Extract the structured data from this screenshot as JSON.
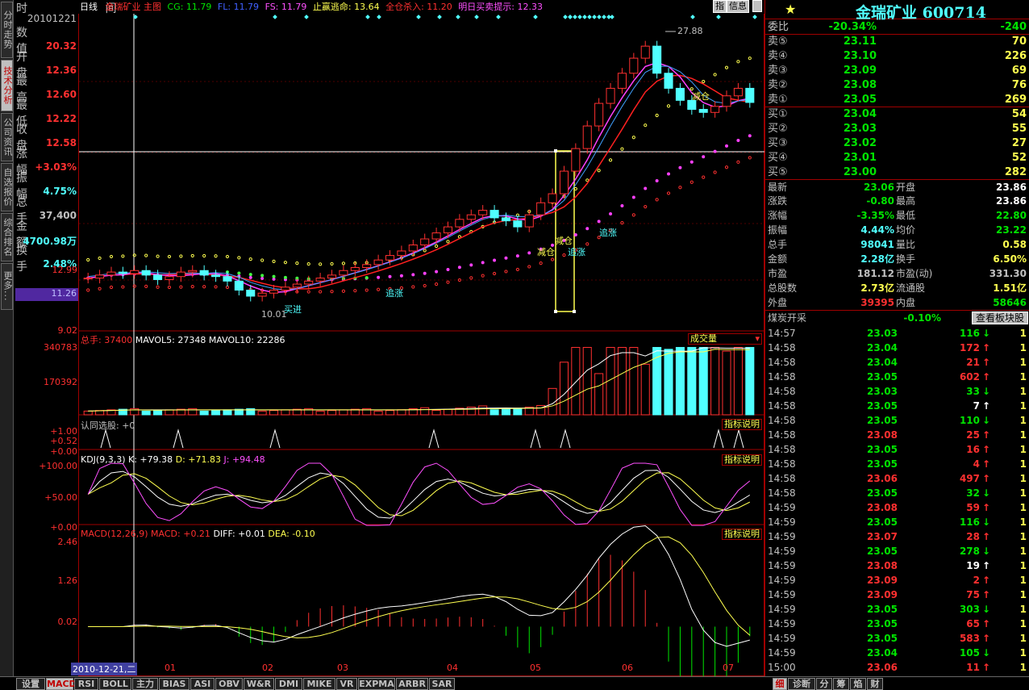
{
  "left_tabs": [
    "分时走势",
    "技术分析",
    "公司资讯",
    "自选报价",
    "综合排名",
    "更多..."
  ],
  "info": {
    "time_label": "时 间",
    "date": "20101221",
    "rows": [
      {
        "label": "数 值",
        "value": "20.32",
        "color": "#ff3030"
      },
      {
        "label": "开 盘",
        "value": "12.36",
        "color": "#ff3030"
      },
      {
        "label": "最 高",
        "value": "12.60",
        "color": "#ff3030"
      },
      {
        "label": "最 低",
        "value": "12.22",
        "color": "#ff3030"
      },
      {
        "label": "收 盘",
        "value": "12.58",
        "color": "#ff3030"
      },
      {
        "label": "涨 幅",
        "value": "+3.03%",
        "color": "#ff3030"
      },
      {
        "label": "振 幅",
        "value": "4.75%",
        "color": "#50ffff"
      },
      {
        "label": "总 手",
        "value": "37,400",
        "color": "#c0c0c0"
      },
      {
        "label": "金 额",
        "value": "4700.98万",
        "color": "#50ffff"
      },
      {
        "label": "换 手",
        "value": "2.48%",
        "color": "#50ffff"
      }
    ]
  },
  "header": {
    "period": "日线",
    "name": "金瑞矿业",
    "chart": "主图",
    "cg": "CG: 11.79",
    "fl": "FL: 11.79",
    "fs": "FS: 11.79",
    "zzt": "止赢逃命: 13.64",
    "qcs": "全仓杀入: 11.20",
    "mr": "明日买卖提示: 12.33",
    "btn_zb": "指",
    "btn_info": "信息"
  },
  "axis": {
    "price": [
      "12.99",
      "11.26",
      "9.02"
    ],
    "vol": [
      "340783",
      "170392"
    ],
    "xg": [
      "+1.00",
      "+0.52",
      "+0.00"
    ],
    "kdj": [
      "+100.00",
      "+50.00",
      "+0.00"
    ],
    "macd": [
      "2.46",
      "1.26",
      "0.02"
    ],
    "months": [
      "01",
      "02",
      "03",
      "04",
      "05",
      "06",
      "07"
    ],
    "date_box": "2010-12-21,二"
  },
  "annotations": {
    "high": "27.88",
    "low": "10.01",
    "buy": "买进",
    "zz1": "追涨",
    "zz2": "追涨",
    "zz3": "追涨",
    "jc1": "减仓",
    "jc2": "减仓",
    "jc3": "减仓"
  },
  "vol_panel": {
    "title_a": "总手: 37400",
    "title_b": "MAVOL5: 27348",
    "title_c": "MAVOL10: 22286",
    "btn": "成交量"
  },
  "xg_panel": {
    "title": "认同选股: +0",
    "btn": "指标说明"
  },
  "kdj_panel": {
    "title_a": "KDJ(9,3,3)",
    "title_b": "K: +79.38",
    "title_c": "D: +71.83",
    "title_d": "J: +94.48",
    "btn": "指标说明"
  },
  "macd_panel": {
    "title_a": "MACD(12,26,9)",
    "title_b": "MACD: +0.21",
    "title_c": "DIFF: +0.01",
    "title_d": "DEA: -0.10",
    "btn": "指标说明"
  },
  "title": {
    "star": "★",
    "text": "金瑞矿业  600714"
  },
  "weibi": {
    "label": "委比",
    "pct": "-20.34%",
    "val": "-240"
  },
  "quotes": [
    {
      "label": "卖⑤",
      "price": "23.11",
      "vol": "70"
    },
    {
      "label": "卖④",
      "price": "23.10",
      "vol": "226"
    },
    {
      "label": "卖③",
      "price": "23.09",
      "vol": "69"
    },
    {
      "label": "卖②",
      "price": "23.08",
      "vol": "76"
    },
    {
      "label": "卖①",
      "price": "23.05",
      "vol": "269"
    },
    {
      "label": "买①",
      "price": "23.04",
      "vol": "54"
    },
    {
      "label": "买②",
      "price": "23.03",
      "vol": "55"
    },
    {
      "label": "买③",
      "price": "23.02",
      "vol": "27"
    },
    {
      "label": "买④",
      "price": "23.01",
      "vol": "52"
    },
    {
      "label": "买⑤",
      "price": "23.00",
      "vol": "282"
    }
  ],
  "stats": [
    {
      "l1": "最新",
      "v1": "23.06",
      "c1": "#00e400",
      "l2": "开盘",
      "v2": "23.86",
      "c2": "#ffffff"
    },
    {
      "l1": "涨跌",
      "v1": "-0.80",
      "c1": "#00e400",
      "l2": "最高",
      "v2": "23.86",
      "c2": "#ffffff"
    },
    {
      "l1": "涨幅",
      "v1": "-3.35%",
      "c1": "#00e400",
      "l2": "最低",
      "v2": "22.80",
      "c2": "#00e400"
    },
    {
      "l1": "振幅",
      "v1": "4.44%",
      "c1": "#50ffff",
      "l2": "均价",
      "v2": "23.22",
      "c2": "#00e400"
    },
    {
      "l1": "总手",
      "v1": "98041",
      "c1": "#50ffff",
      "l2": "量比",
      "v2": "0.58",
      "c2": "#ffff50"
    },
    {
      "l1": "金额",
      "v1": "2.28亿",
      "c1": "#50ffff",
      "l2": "换手",
      "v2": "6.50%",
      "c2": "#ffff50"
    },
    {
      "l1": "市盈",
      "v1": "181.12",
      "c1": "#c0c0c0",
      "l2": "市盈(动)",
      "v2": "331.30",
      "c2": "#c0c0c0"
    },
    {
      "l1": "总股数",
      "v1": "2.73亿",
      "c1": "#ffff50",
      "l2": "流通股",
      "v2": "1.51亿",
      "c2": "#ffff50"
    },
    {
      "l1": "外盘",
      "v1": "39395",
      "c1": "#ff3030",
      "l2": "内盘",
      "v2": "58646",
      "c2": "#00e400"
    }
  ],
  "sector": {
    "name": "煤炭开采",
    "pct": "-0.10%",
    "btn": "查看板块股"
  },
  "ticks": [
    {
      "t": "14:57",
      "p": "23.03",
      "v": "116",
      "d": "down",
      "n": "1"
    },
    {
      "t": "14:58",
      "p": "23.04",
      "v": "172",
      "d": "up",
      "n": "1"
    },
    {
      "t": "14:58",
      "p": "23.04",
      "v": "21",
      "d": "up",
      "n": "1"
    },
    {
      "t": "14:58",
      "p": "23.05",
      "v": "602",
      "d": "up",
      "n": "1"
    },
    {
      "t": "14:58",
      "p": "23.03",
      "v": "33",
      "d": "down",
      "n": "1"
    },
    {
      "t": "14:58",
      "p": "23.05",
      "v": "7",
      "d": "neutral",
      "n": "1"
    },
    {
      "t": "14:58",
      "p": "23.05",
      "v": "110",
      "d": "down",
      "n": "1"
    },
    {
      "t": "14:58",
      "p": "23.08",
      "v": "25",
      "d": "up",
      "n": "1"
    },
    {
      "t": "14:58",
      "p": "23.05",
      "v": "16",
      "d": "up",
      "n": "1"
    },
    {
      "t": "14:58",
      "p": "23.05",
      "v": "4",
      "d": "up",
      "n": "1"
    },
    {
      "t": "14:58",
      "p": "23.06",
      "v": "497",
      "d": "up",
      "n": "1"
    },
    {
      "t": "14:58",
      "p": "23.05",
      "v": "32",
      "d": "down",
      "n": "1"
    },
    {
      "t": "14:59",
      "p": "23.08",
      "v": "59",
      "d": "up",
      "n": "1"
    },
    {
      "t": "14:59",
      "p": "23.05",
      "v": "116",
      "d": "down",
      "n": "1"
    },
    {
      "t": "14:59",
      "p": "23.07",
      "v": "28",
      "d": "up",
      "n": "1"
    },
    {
      "t": "14:59",
      "p": "23.05",
      "v": "278",
      "d": "down",
      "n": "1"
    },
    {
      "t": "14:59",
      "p": "23.08",
      "v": "19",
      "d": "neutral",
      "n": "1"
    },
    {
      "t": "14:59",
      "p": "23.09",
      "v": "2",
      "d": "up",
      "n": "1"
    },
    {
      "t": "14:59",
      "p": "23.09",
      "v": "75",
      "d": "up",
      "n": "1"
    },
    {
      "t": "14:59",
      "p": "23.05",
      "v": "303",
      "d": "down",
      "n": "1"
    },
    {
      "t": "14:59",
      "p": "23.05",
      "v": "65",
      "d": "up",
      "n": "1"
    },
    {
      "t": "14:59",
      "p": "23.05",
      "v": "583",
      "d": "up",
      "n": "1"
    },
    {
      "t": "14:59",
      "p": "23.04",
      "v": "105",
      "d": "down",
      "n": "1"
    },
    {
      "t": "15:00",
      "p": "23.06",
      "v": "11",
      "d": "up",
      "n": "1"
    }
  ],
  "bottom_tabs": [
    "设置",
    "MACD",
    "RSI",
    "BOLL",
    "主力",
    "BIAS",
    "ASI",
    "OBV",
    "W&R",
    "DMI",
    "MIKE",
    "VR",
    "EXPMA",
    "ARBR",
    "SAR"
  ],
  "right_tabs": [
    "细",
    "诊断",
    "分",
    "筹",
    "焰",
    "财"
  ],
  "chart_data": {
    "type": "line",
    "title": "金瑞矿业 日线",
    "xlabel": "",
    "ylabel": "",
    "x_ticks": [
      "01",
      "02",
      "03",
      "04",
      "05",
      "06",
      "07"
    ],
    "price_ylim": [
      9.02,
      27.88
    ],
    "close": [
      11.4,
      11.6,
      11.8,
      11.7,
      11.9,
      11.6,
      11.3,
      11.5,
      11.8,
      11.9,
      11.6,
      11.5,
      11.2,
      10.6,
      10.2,
      10.4,
      10.6,
      10.8,
      11.0,
      11.2,
      11.4,
      11.6,
      11.9,
      12.1,
      12.3,
      12.6,
      12.9,
      13.2,
      13.6,
      14.0,
      14.4,
      14.8,
      15.3,
      15.6,
      15.9,
      15.4,
      15.2,
      14.8,
      15.6,
      16.4,
      17.0,
      18.5,
      20.0,
      21.5,
      23.0,
      24.0,
      25.0,
      26.0,
      26.8,
      25.0,
      24.0,
      23.2,
      22.6,
      22.4,
      22.8,
      23.5,
      24.0,
      23.06
    ],
    "high": 27.88,
    "low": 10.01,
    "volume_ylim": [
      0,
      340783
    ],
    "mavol5": 27348,
    "mavol10": 22286,
    "kdj": {
      "K": 79.38,
      "D": 71.83,
      "J": 94.48,
      "ylim": [
        0,
        100
      ]
    },
    "macd": {
      "MACD": 0.21,
      "DIFF": 0.01,
      "DEA": -0.1,
      "ylim": [
        0.02,
        2.46
      ]
    }
  }
}
